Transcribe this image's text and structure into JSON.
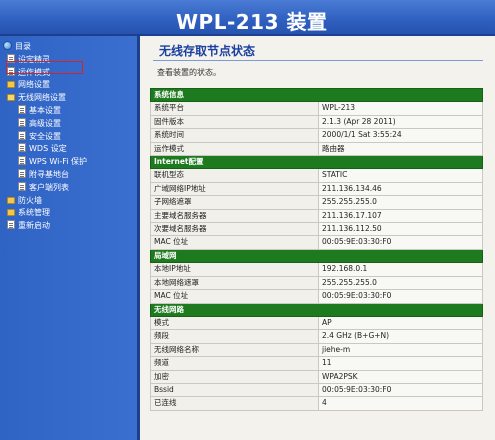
{
  "header": {
    "title": "WPL-213 装置"
  },
  "sidebar": {
    "items": [
      {
        "label": "目录",
        "icon": "globe-icon",
        "level": 0
      },
      {
        "label": "设定精灵",
        "icon": "document-icon",
        "level": 1
      },
      {
        "label": "运作模式",
        "icon": "document-icon",
        "level": 1
      },
      {
        "label": "网络设置",
        "icon": "folder-icon",
        "level": 1
      },
      {
        "label": "无线网络设置",
        "icon": "folder-open-icon",
        "level": 1,
        "selected": true
      },
      {
        "label": "基本设置",
        "icon": "document-icon",
        "level": 2
      },
      {
        "label": "高级设置",
        "icon": "document-icon",
        "level": 2
      },
      {
        "label": "安全设置",
        "icon": "document-icon",
        "level": 2
      },
      {
        "label": "WDS 设定",
        "icon": "document-icon",
        "level": 2
      },
      {
        "label": "WPS Wi-Fi 保护",
        "icon": "document-icon",
        "level": 2
      },
      {
        "label": "附寻基地台",
        "icon": "document-icon",
        "level": 2
      },
      {
        "label": "客户端列表",
        "icon": "document-icon",
        "level": 2
      },
      {
        "label": "防火墙",
        "icon": "folder-icon",
        "level": 1
      },
      {
        "label": "系统管理",
        "icon": "folder-icon",
        "level": 1
      },
      {
        "label": "重新启动",
        "icon": "document-icon",
        "level": 1
      }
    ]
  },
  "main": {
    "title": "无线存取节点状态",
    "subtitle": "查看装置的状态。",
    "sections": [
      {
        "header": "系统信息",
        "rows": [
          {
            "label": "系统平台",
            "value": "WPL-213"
          },
          {
            "label": "固件版本",
            "value": "2.1.3 (Apr 28 2011)"
          },
          {
            "label": "系统时间",
            "value": "2000/1/1 Sat 3:55:24"
          },
          {
            "label": "运作模式",
            "value": "路由器"
          }
        ]
      },
      {
        "header": "Internet配置",
        "rows": [
          {
            "label": "联机型态",
            "value": "STATIC"
          },
          {
            "label": "广域网络IP地址",
            "value": "211.136.134.46"
          },
          {
            "label": "子网络遮罩",
            "value": "255.255.255.0"
          },
          {
            "label": "主要域名服务器",
            "value": "211.136.17.107"
          },
          {
            "label": "次要域名服务器",
            "value": "211.136.112.50"
          },
          {
            "label": "MAC 位址",
            "value": "00:05:9E:03:30:F0"
          }
        ]
      },
      {
        "header": "局域网",
        "rows": [
          {
            "label": "本地IP地址",
            "value": "192.168.0.1"
          },
          {
            "label": "本地网络遮罩",
            "value": "255.255.255.0"
          },
          {
            "label": "MAC 位址",
            "value": "00:05:9E:03:30:F0"
          }
        ]
      },
      {
        "header": "无线网路",
        "rows": [
          {
            "label": "模式",
            "value": "AP"
          },
          {
            "label": "频段",
            "value": "2.4 GHz (B+G+N)"
          },
          {
            "label": "无线网络名称",
            "value": "jiehe-m"
          },
          {
            "label": "频道",
            "value": "11"
          },
          {
            "label": "加密",
            "value": "WPA2PSK"
          },
          {
            "label": "Bssid",
            "value": "00:05:9E:03:30:F0"
          },
          {
            "label": "已连线",
            "value": "4"
          }
        ]
      }
    ]
  }
}
